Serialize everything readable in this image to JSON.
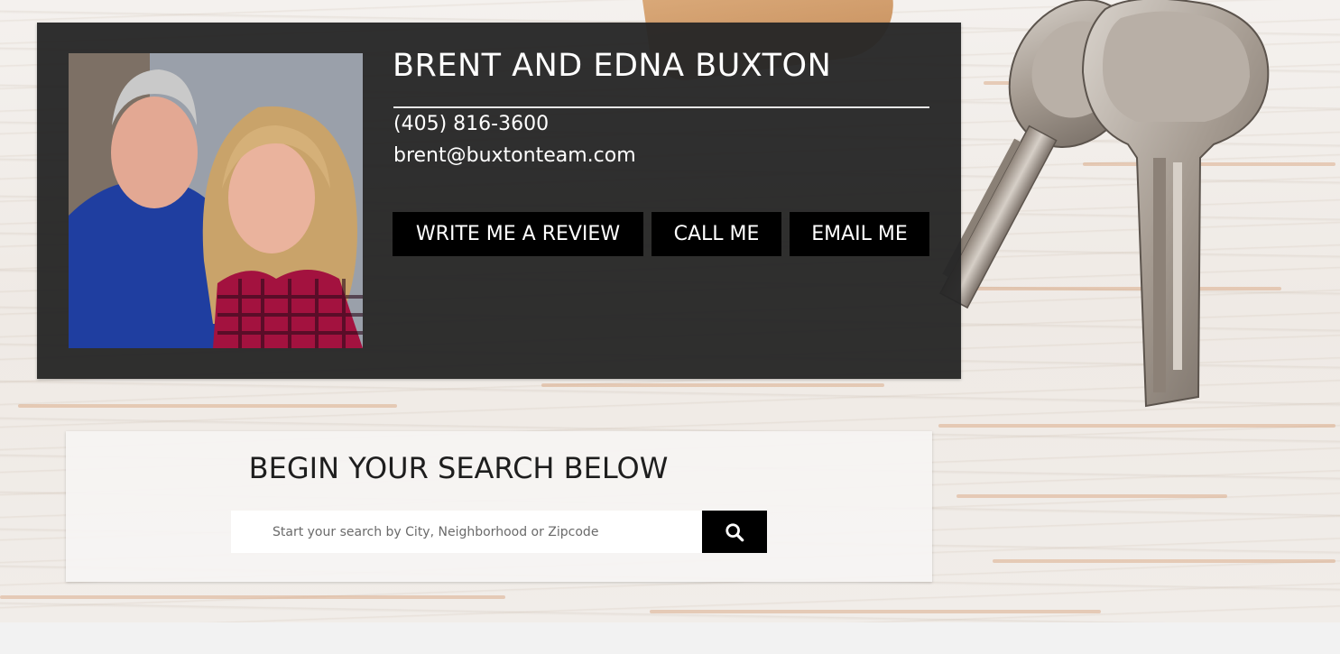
{
  "agent": {
    "name": "BRENT AND EDNA BUXTON",
    "phone": "(405) 816-3600",
    "email": "brent@buxtonteam.com",
    "photo_icon": "agent-photo"
  },
  "actions": {
    "review_label": "WRITE ME A REVIEW",
    "call_label": "CALL ME",
    "email_label": "EMAIL ME"
  },
  "search": {
    "title": "BEGIN YOUR SEARCH BELOW",
    "placeholder": "Start your search by City, Neighborhood or Zipcode",
    "button_icon": "search-icon"
  },
  "colors": {
    "card_bg": "#262626",
    "button_bg": "#000000",
    "text_light": "#ffffff",
    "panel_bg": "#f6f4f3"
  }
}
